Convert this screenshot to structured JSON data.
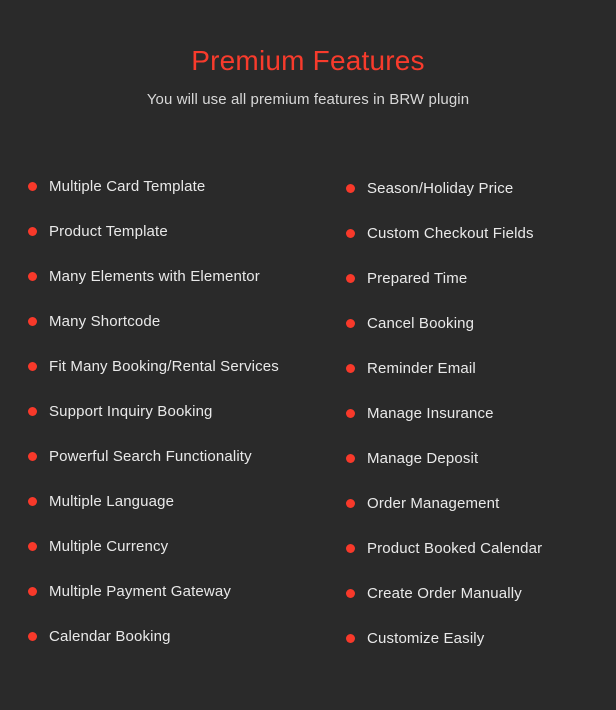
{
  "header": {
    "title": "Premium Features",
    "subtitle": "You will use all premium features in BRW plugin"
  },
  "colors": {
    "background": "#2a2a2a",
    "accent": "#f8392a",
    "title": "#f83b2c",
    "text": "#e9e9e9",
    "subtitle_text": "#d8d8d8"
  },
  "columns": {
    "left": {
      "items": [
        {
          "bullet_icon": "dot-icon",
          "label": "Multiple Card Template"
        },
        {
          "bullet_icon": "dot-icon",
          "label": "Product Template"
        },
        {
          "bullet_icon": "dot-icon",
          "label": "Many Elements with Elementor"
        },
        {
          "bullet_icon": "dot-icon",
          "label": "Many Shortcode"
        },
        {
          "bullet_icon": "dot-icon",
          "label": "Fit Many Booking/Rental Services"
        },
        {
          "bullet_icon": "dot-icon",
          "label": "Support Inquiry Booking"
        },
        {
          "bullet_icon": "dot-icon",
          "label": "Powerful Search Functionality"
        },
        {
          "bullet_icon": "dot-icon",
          "label": "Multiple Language"
        },
        {
          "bullet_icon": "dot-icon",
          "label": "Multiple Currency"
        },
        {
          "bullet_icon": "dot-icon",
          "label": "Multiple Payment Gateway"
        },
        {
          "bullet_icon": "dot-icon",
          "label": "Calendar Booking"
        }
      ]
    },
    "right": {
      "items": [
        {
          "bullet_icon": "dot-icon",
          "label": "Season/Holiday Price"
        },
        {
          "bullet_icon": "dot-icon",
          "label": "Custom Checkout Fields"
        },
        {
          "bullet_icon": "dot-icon",
          "label": "Prepared Time"
        },
        {
          "bullet_icon": "dot-icon",
          "label": "Cancel Booking"
        },
        {
          "bullet_icon": "dot-icon",
          "label": "Reminder Email"
        },
        {
          "bullet_icon": "dot-icon",
          "label": "Manage Insurance"
        },
        {
          "bullet_icon": "dot-icon",
          "label": "Manage Deposit"
        },
        {
          "bullet_icon": "dot-icon",
          "label": "Order Management"
        },
        {
          "bullet_icon": "dot-icon",
          "label": "Product Booked Calendar"
        },
        {
          "bullet_icon": "dot-icon",
          "label": "Create Order Manually"
        },
        {
          "bullet_icon": "dot-icon",
          "label": "Customize Easily"
        }
      ]
    }
  }
}
